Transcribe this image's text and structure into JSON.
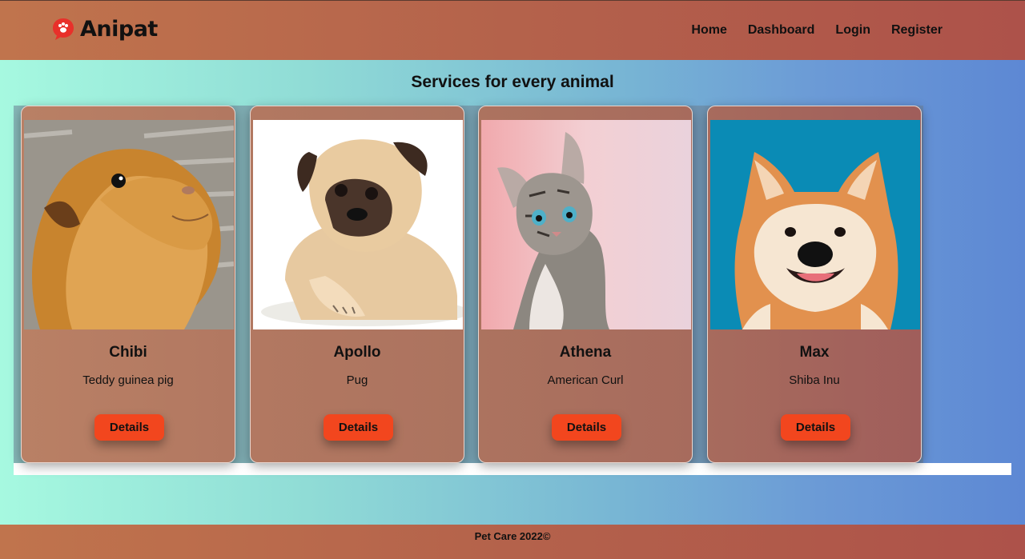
{
  "brand": {
    "name": "Anipat",
    "icon": "paw-chat-bubble-icon",
    "color": "#e8302a"
  },
  "nav": {
    "items": [
      "Home",
      "Dashboard",
      "Login",
      "Register"
    ]
  },
  "page": {
    "heading": "Services for every animal"
  },
  "cards": [
    {
      "name": "Chibi",
      "breed": "Teddy guinea pig",
      "button": "Details",
      "image": "guinea-pig-photo"
    },
    {
      "name": "Apollo",
      "breed": "Pug",
      "button": "Details",
      "image": "pug-photo"
    },
    {
      "name": "Athena",
      "breed": "American Curl",
      "button": "Details",
      "image": "kitten-photo"
    },
    {
      "name": "Max",
      "breed": "Shiba Inu",
      "button": "Details",
      "image": "shiba-inu-photo"
    }
  ],
  "footer": {
    "text": "Pet Care 2022©"
  },
  "colors": {
    "accent": "#f2461e",
    "header": "#b4624b"
  }
}
